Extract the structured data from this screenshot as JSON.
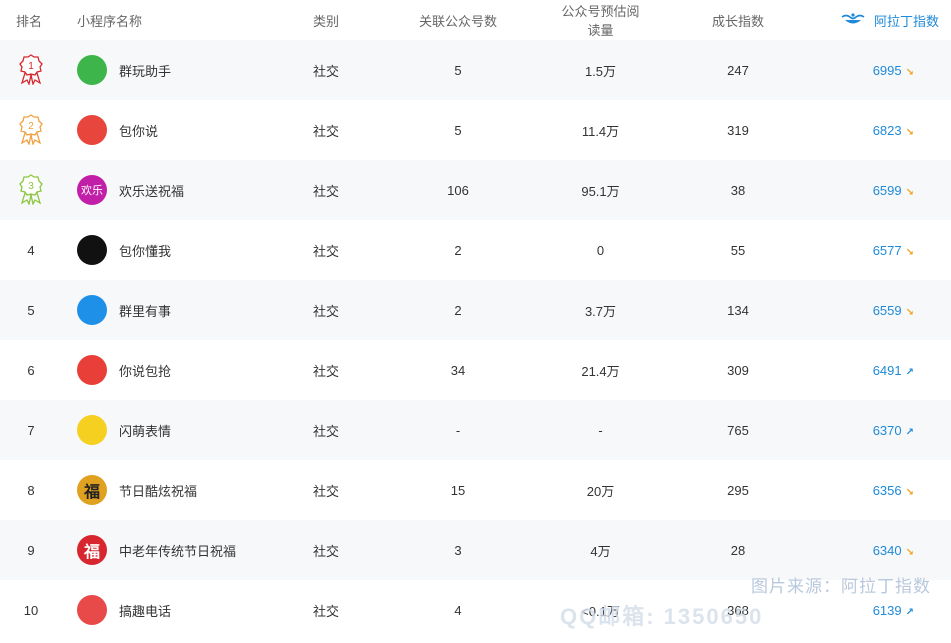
{
  "header": {
    "rank": "排名",
    "name": "小程序名称",
    "category": "类别",
    "linked_accounts": "关联公众号数",
    "est_reads": "公众号预估阅读量",
    "growth": "成长指数",
    "index": "阿拉丁指数"
  },
  "rows": [
    {
      "rank": "1",
      "name": "群玩助手",
      "category": "社交",
      "linked": "5",
      "reads": "1.5万",
      "growth": "247",
      "index": "6995",
      "trend": "down",
      "icon_color": "#3db54a",
      "icon_text": ""
    },
    {
      "rank": "2",
      "name": "包你说",
      "category": "社交",
      "linked": "5",
      "reads": "11.4万",
      "growth": "319",
      "index": "6823",
      "trend": "down",
      "icon_color": "#e8453c",
      "icon_text": ""
    },
    {
      "rank": "3",
      "name": "欢乐送祝福",
      "category": "社交",
      "linked": "106",
      "reads": "95.1万",
      "growth": "38",
      "index": "6599",
      "trend": "down",
      "icon_color": "#c21fa8",
      "icon_text": "欢乐"
    },
    {
      "rank": "4",
      "name": "包你懂我",
      "category": "社交",
      "linked": "2",
      "reads": "0",
      "growth": "55",
      "index": "6577",
      "trend": "down",
      "icon_color": "#111111",
      "icon_text": ""
    },
    {
      "rank": "5",
      "name": "群里有事",
      "category": "社交",
      "linked": "2",
      "reads": "3.7万",
      "growth": "134",
      "index": "6559",
      "trend": "down",
      "icon_color": "#1e90e8",
      "icon_text": ""
    },
    {
      "rank": "6",
      "name": "你说包抢",
      "category": "社交",
      "linked": "34",
      "reads": "21.4万",
      "growth": "309",
      "index": "6491",
      "trend": "up",
      "icon_color": "#e84038",
      "icon_text": ""
    },
    {
      "rank": "7",
      "name": "闪萌表情",
      "category": "社交",
      "linked": "-",
      "reads": "-",
      "growth": "765",
      "index": "6370",
      "trend": "up",
      "icon_color": "#f5d020",
      "icon_text": ""
    },
    {
      "rank": "8",
      "name": "节日酷炫祝福",
      "category": "社交",
      "linked": "15",
      "reads": "20万",
      "growth": "295",
      "index": "6356",
      "trend": "down",
      "icon_color": "#e0a020",
      "icon_text": "福"
    },
    {
      "rank": "9",
      "name": "中老年传统节日祝福",
      "category": "社交",
      "linked": "3",
      "reads": "4万",
      "growth": "28",
      "index": "6340",
      "trend": "down",
      "icon_color": "#d8262e",
      "icon_text": "福"
    },
    {
      "rank": "10",
      "name": "搞趣电话",
      "category": "社交",
      "linked": "4",
      "reads": "<0.1万",
      "growth": "368",
      "index": "6139",
      "trend": "up",
      "icon_color": "#e84a4a",
      "icon_text": ""
    }
  ],
  "medal_colors": {
    "1": "#d8262e",
    "2": "#f0a040",
    "3": "#8cc63f"
  },
  "watermark": "图片来源：阿拉丁指数",
  "watermark2": "QQ邮箱: 1350650"
}
